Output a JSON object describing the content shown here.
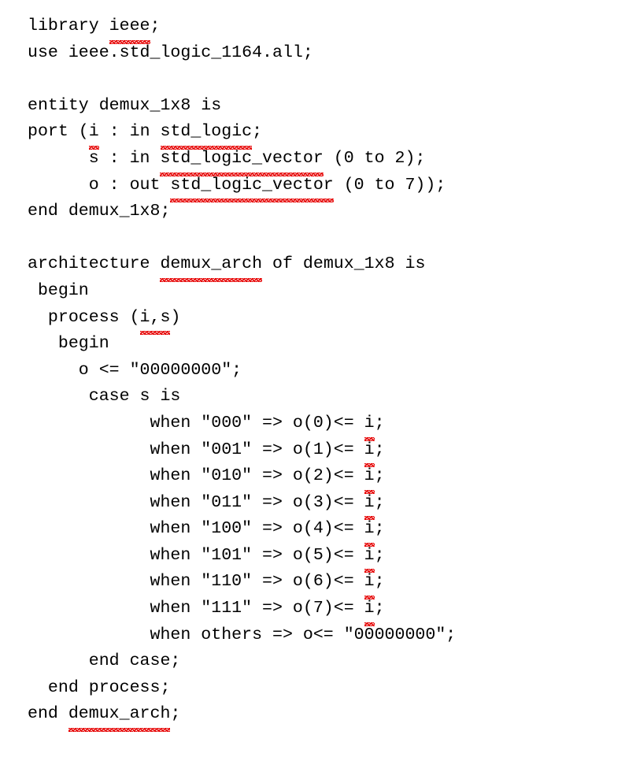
{
  "document": {
    "kind": "vhdl-source-listing",
    "language": "VHDL",
    "background_color": "#ffffff",
    "text_color": "#000000",
    "spellcheck_underline_color": "#e60000",
    "lines": [
      {
        "id": "line-1",
        "text": "library ieee;",
        "misspelled": [
          "ieee"
        ]
      },
      {
        "id": "line-2",
        "text": "use ieee.std_logic_1164.all;",
        "misspelled": []
      },
      {
        "id": "line-3",
        "text": "",
        "misspelled": []
      },
      {
        "id": "line-4",
        "text": "entity demux_1x8 is",
        "misspelled": []
      },
      {
        "id": "line-5",
        "text": "port (i : in std_logic;",
        "misspelled": [
          "i",
          "std_logic"
        ]
      },
      {
        "id": "line-6",
        "text": "      s : in std_logic_vector (0 to 2);",
        "misspelled": [
          "std_logic_vector"
        ]
      },
      {
        "id": "line-7",
        "text": "      o : out std_logic_vector (0 to 7));",
        "misspelled": [
          "std_logic_vector"
        ]
      },
      {
        "id": "line-8",
        "text": "end demux_1x8;",
        "misspelled": []
      },
      {
        "id": "line-9",
        "text": "",
        "misspelled": []
      },
      {
        "id": "line-10",
        "text": "architecture demux_arch of demux_1x8 is",
        "misspelled": [
          "demux_arch"
        ]
      },
      {
        "id": "line-11",
        "text": " begin",
        "misspelled": []
      },
      {
        "id": "line-12",
        "text": "  process (i,s)",
        "misspelled": [
          "i,s"
        ]
      },
      {
        "id": "line-13",
        "text": "   begin",
        "misspelled": []
      },
      {
        "id": "line-14",
        "text": "     o <= \"00000000\";",
        "misspelled": []
      },
      {
        "id": "line-15",
        "text": "      case s is",
        "misspelled": []
      },
      {
        "id": "line-16",
        "text": "            when \"000\" => o(0)<= i;",
        "misspelled": [
          "i"
        ]
      },
      {
        "id": "line-17",
        "text": "            when \"001\" => o(1)<= i;",
        "misspelled": [
          "i"
        ]
      },
      {
        "id": "line-18",
        "text": "            when \"010\" => o(2)<= i;",
        "misspelled": [
          "i"
        ]
      },
      {
        "id": "line-19",
        "text": "            when \"011\" => o(3)<= i;",
        "misspelled": [
          "i"
        ]
      },
      {
        "id": "line-20",
        "text": "            when \"100\" => o(4)<= i;",
        "misspelled": [
          "i"
        ]
      },
      {
        "id": "line-21",
        "text": "            when \"101\" => o(5)<= i;",
        "misspelled": [
          "i"
        ]
      },
      {
        "id": "line-22",
        "text": "            when \"110\" => o(6)<= i;",
        "misspelled": [
          "i"
        ]
      },
      {
        "id": "line-23",
        "text": "            when \"111\" => o(7)<= i;",
        "misspelled": [
          "i"
        ]
      },
      {
        "id": "line-24",
        "text": "            when others => o<= \"00000000\";",
        "misspelled": []
      },
      {
        "id": "line-25",
        "text": "      end case;",
        "misspelled": []
      },
      {
        "id": "line-26",
        "text": "  end process;",
        "misspelled": []
      },
      {
        "id": "line-27",
        "text": "end demux_arch;",
        "misspelled": [
          "demux_arch"
        ]
      }
    ]
  }
}
